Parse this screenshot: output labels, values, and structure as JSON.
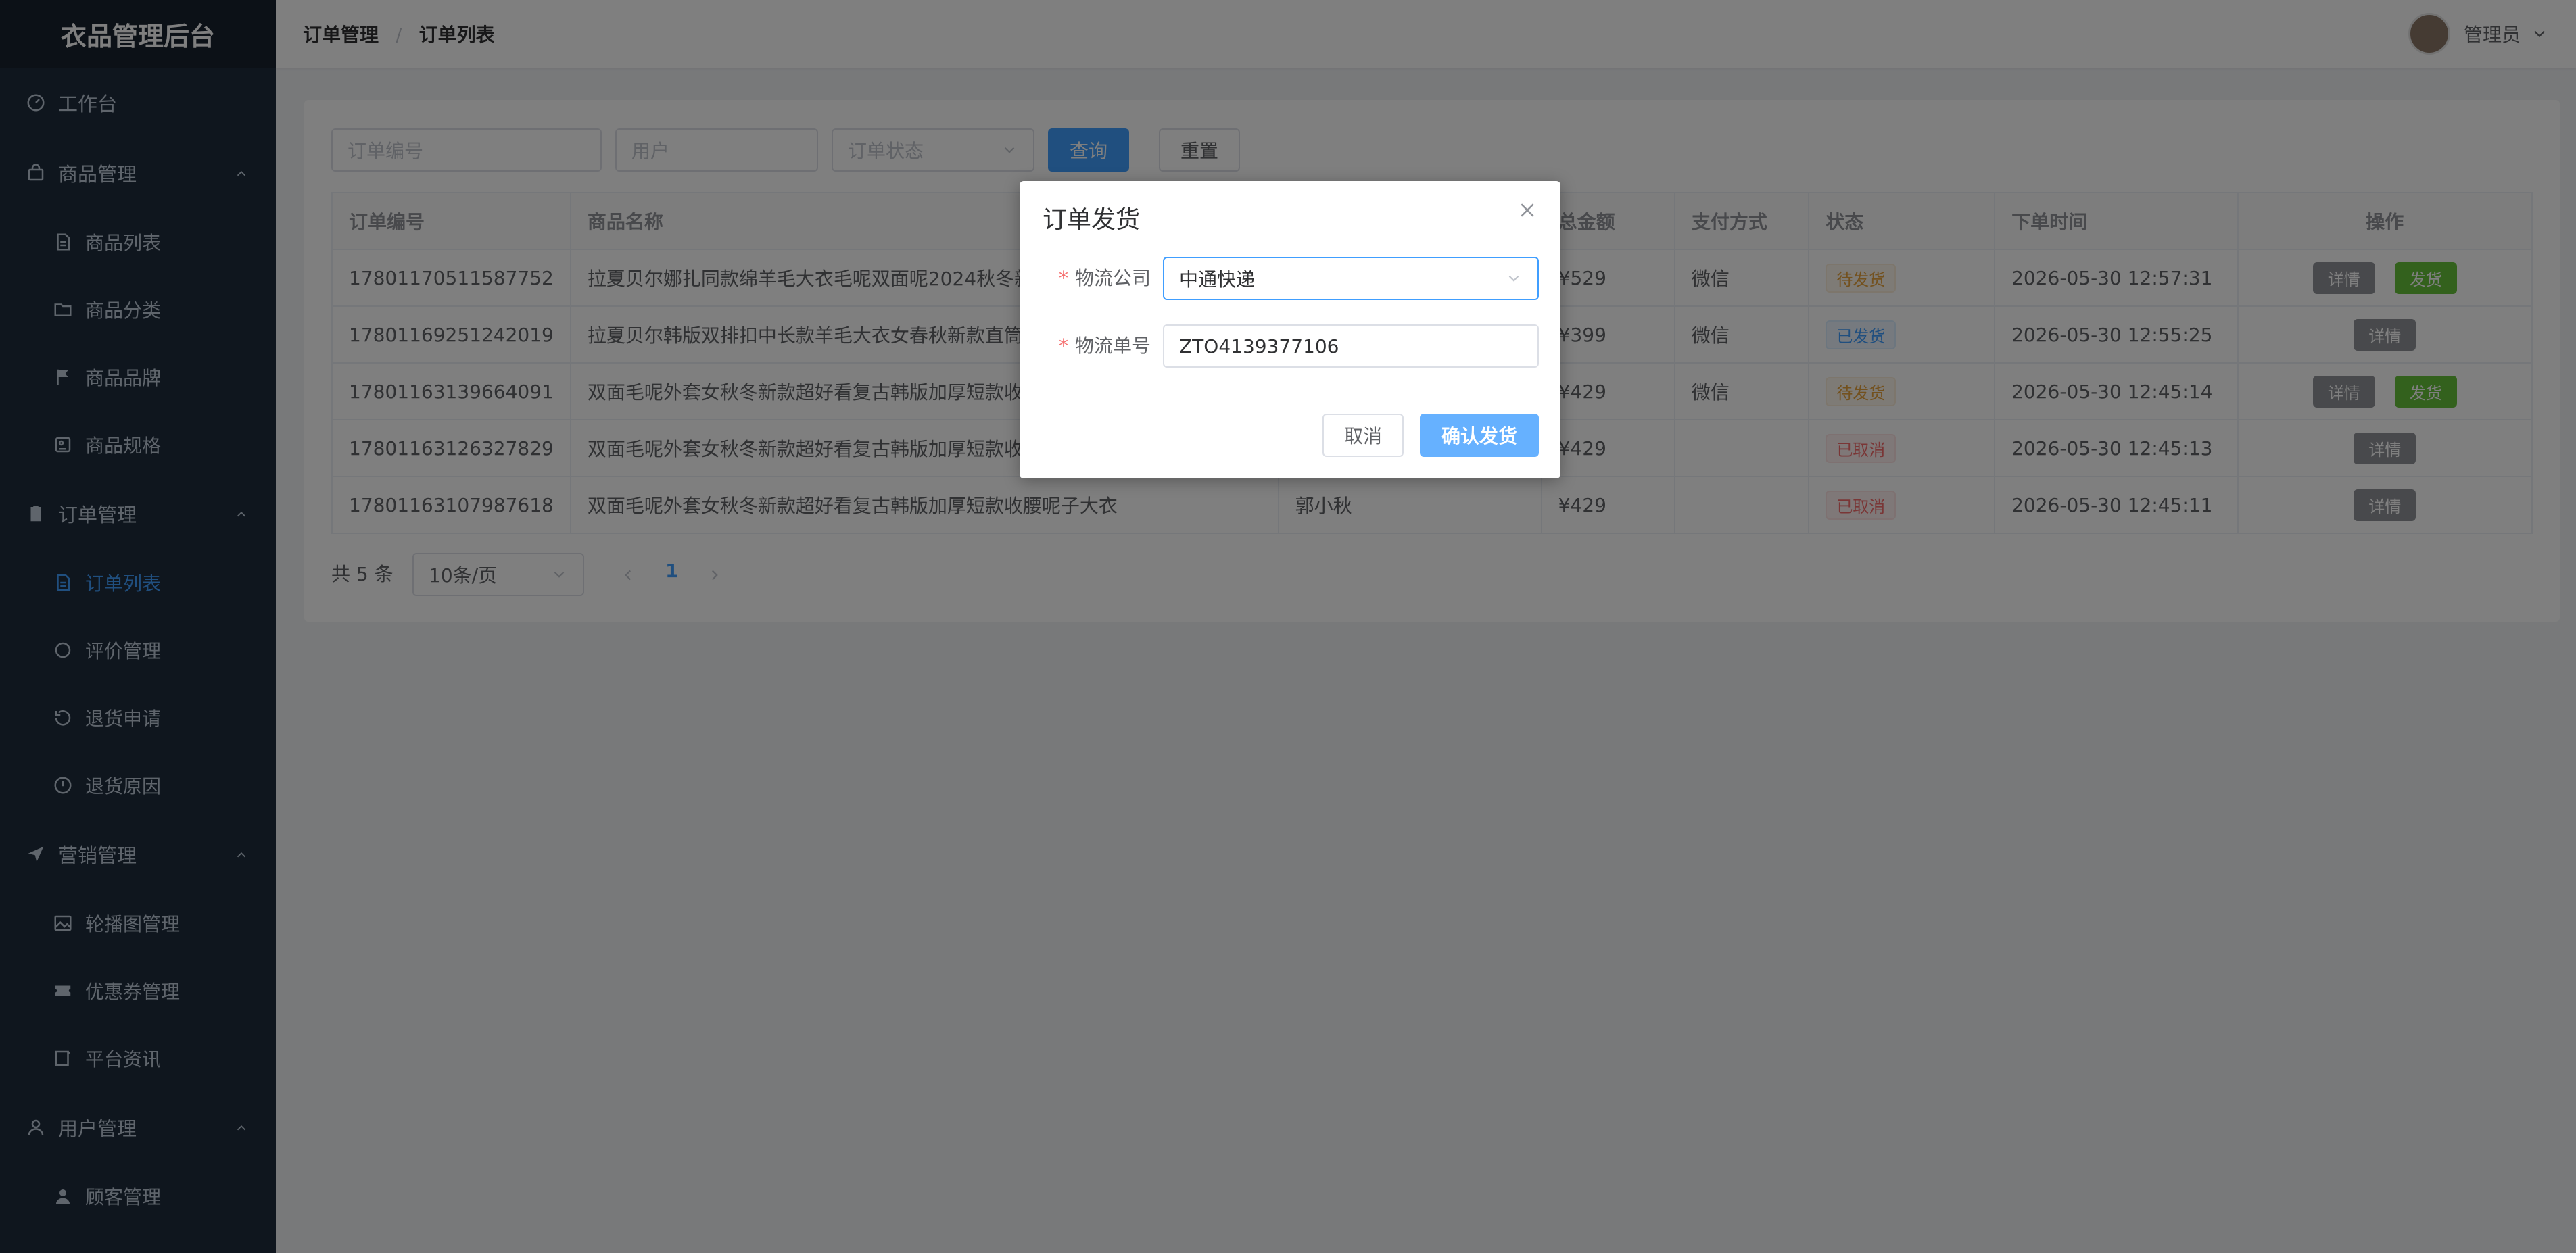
{
  "app_title": "衣品管理后台",
  "sidebar": {
    "workbench": "工作台",
    "groups": [
      {
        "label": "商品管理",
        "items": [
          "商品列表",
          "商品分类",
          "商品品牌",
          "商品规格"
        ]
      },
      {
        "label": "订单管理",
        "items": [
          "订单列表",
          "评价管理",
          "退货申请",
          "退货原因"
        ]
      },
      {
        "label": "营销管理",
        "items": [
          "轮播图管理",
          "优惠券管理",
          "平台资讯"
        ]
      },
      {
        "label": "用户管理",
        "items": [
          "顾客管理"
        ]
      }
    ]
  },
  "header": {
    "breadcrumb": [
      "订单管理",
      "订单列表"
    ],
    "breadcrumb_sep": "/",
    "user_name": "管理员"
  },
  "filters": {
    "order_no_placeholder": "订单编号",
    "user_placeholder": "用户",
    "status_placeholder": "订单状态",
    "query_label": "查询",
    "reset_label": "重置"
  },
  "table": {
    "headers": [
      "订单编号",
      "商品名称",
      "",
      "总金额",
      "支付方式",
      "状态",
      "下单时间",
      "操作"
    ],
    "rows": [
      {
        "order_no": "17801170511587752",
        "product": "拉夏贝尔娜扎同款绵羊毛大衣毛呢双面呢2024秋冬新款",
        "user": "",
        "amount": "¥529",
        "payment": "微信",
        "status": "待发货",
        "status_type": "warn",
        "time": "2026-05-30 12:57:31",
        "actions": [
          "详情",
          "发货"
        ]
      },
      {
        "order_no": "17801169251242019",
        "product": "拉夏贝尔韩版双排扣中长款羊毛大衣女春秋新款直筒加",
        "user": "",
        "amount": "¥399",
        "payment": "微信",
        "status": "已发货",
        "status_type": "info",
        "time": "2026-05-30 12:55:25",
        "actions": [
          "详情"
        ]
      },
      {
        "order_no": "17801163139664091",
        "product": "双面毛呢外套女秋冬新款超好看复古韩版加厚短款收腰",
        "user": "",
        "amount": "¥429",
        "payment": "微信",
        "status": "待发货",
        "status_type": "warn",
        "time": "2026-05-30 12:45:14",
        "actions": [
          "详情",
          "发货"
        ]
      },
      {
        "order_no": "17801163126327829",
        "product": "双面毛呢外套女秋冬新款超好看复古韩版加厚短款收腰",
        "user": "",
        "amount": "¥429",
        "payment": "",
        "status": "已取消",
        "status_type": "err",
        "time": "2026-05-30 12:45:13",
        "actions": [
          "详情"
        ]
      },
      {
        "order_no": "17801163107987618",
        "product": "双面毛呢外套女秋冬新款超好看复古韩版加厚短款收腰呢子大衣",
        "user": "郭小秋",
        "amount": "¥429",
        "payment": "",
        "status": "已取消",
        "status_type": "err",
        "time": "2026-05-30 12:45:11",
        "actions": [
          "详情"
        ]
      }
    ]
  },
  "pagination": {
    "total": "共 5 条",
    "page_size": "10条/页",
    "current_page": "1"
  },
  "dialog": {
    "title": "订单发货",
    "company_label": "物流公司",
    "company_value": "中通快递",
    "tracking_label": "物流单号",
    "tracking_value": "ZTO4139377106",
    "cancel_label": "取消",
    "confirm_label": "确认发货",
    "required_mark": "*"
  },
  "colors": {
    "sidebar_bg": "#1f2d3d",
    "accent": "#409eff",
    "confirm": "#66b1ff",
    "success": "#67c23a"
  }
}
